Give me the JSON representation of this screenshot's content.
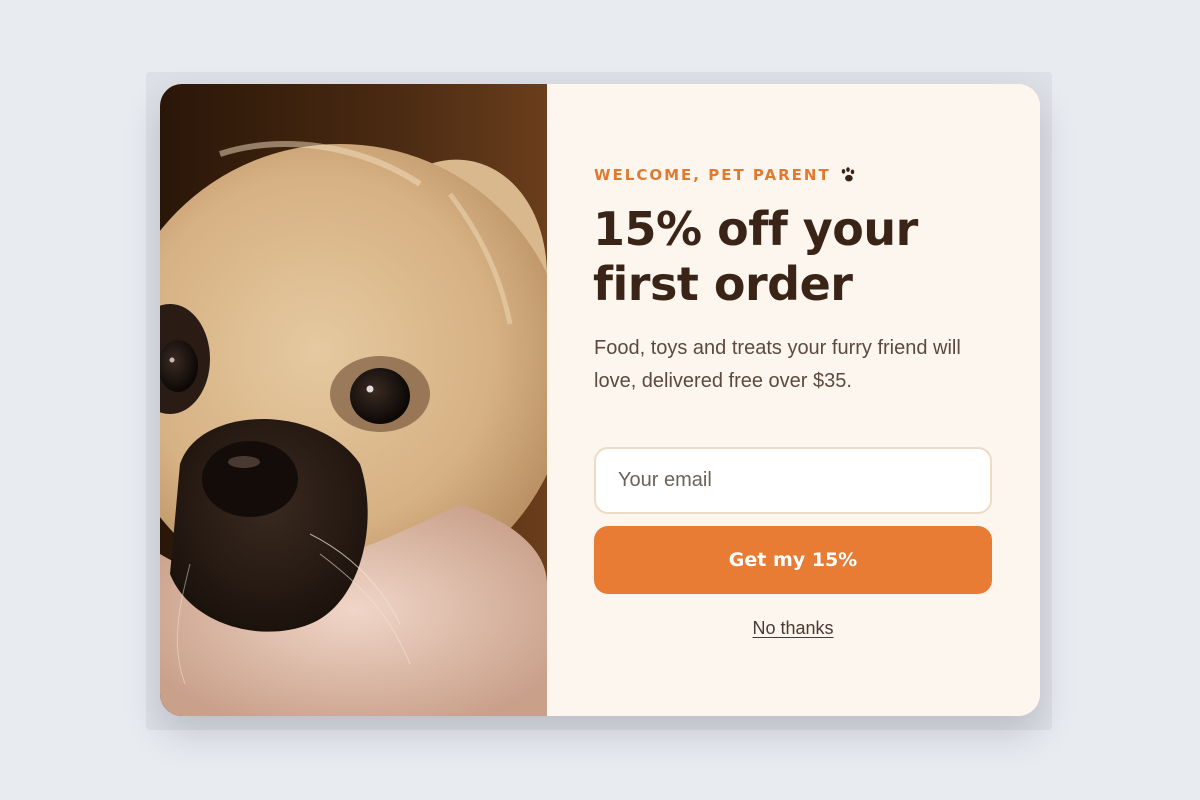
{
  "popup": {
    "eyebrow": "WELCOME, PET PARENT",
    "eyebrow_icon": "paw-icon",
    "headline": "15% off your first order",
    "body": "Food, toys and treats your furry friend will love, delivered free over $35.",
    "email_placeholder": "Your email",
    "cta_label": "Get my 15%",
    "dismiss_label": "No thanks",
    "image": "dog-photo"
  },
  "colors": {
    "accent": "#e87c35",
    "eyebrow": "#e07a32",
    "heading": "#3a2418",
    "panel": "#fdf6ee",
    "page": "#e8ebf0"
  }
}
